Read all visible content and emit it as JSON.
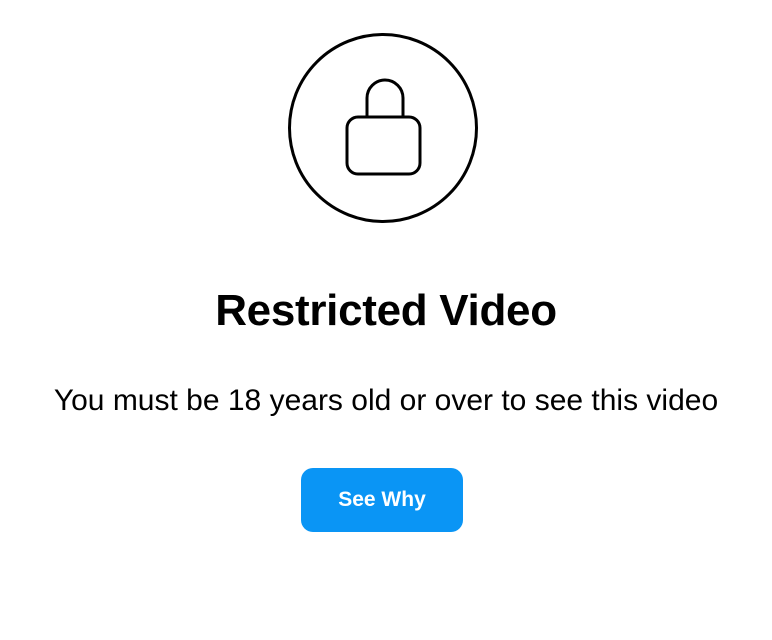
{
  "lock": {
    "icon": "lock-icon"
  },
  "title": "Restricted Video",
  "message": "You must be 18 years old or over to see this video",
  "button": {
    "label": "See Why",
    "color": "#0A95F5"
  }
}
